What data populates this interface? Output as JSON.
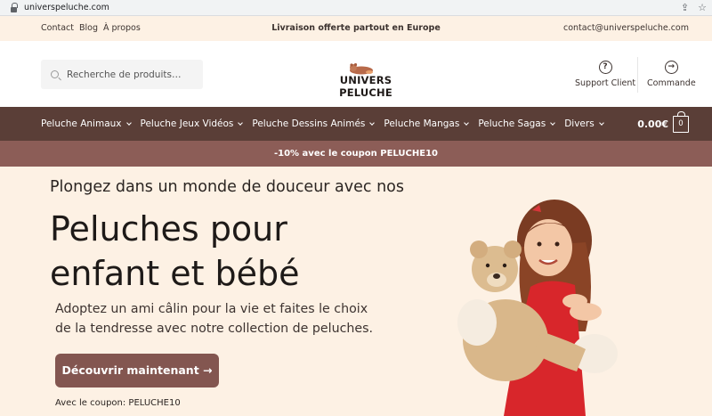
{
  "browser": {
    "url": "universpeluche.com"
  },
  "topbar": {
    "links": [
      "Contact",
      "Blog",
      "À propos"
    ],
    "announcement": "Livraison offerte partout en Europe",
    "email": "contact@universpeluche.com"
  },
  "header": {
    "search_placeholder": "Recherche de produits…",
    "logo_text": "UNIVERS PELUCHE",
    "support_label": "Support Client",
    "order_label": "Commande"
  },
  "nav": {
    "items": [
      "Peluche Animaux",
      "Peluche Jeux Vidéos",
      "Peluche Dessins Animés",
      "Peluche Mangas",
      "Peluche Sagas",
      "Divers"
    ],
    "cart_total": "0.00€",
    "cart_count": "0"
  },
  "coupon_bar": {
    "text": "-10% avec le coupon PELUCHE10"
  },
  "hero": {
    "subtitle": "Plongez dans un monde de douceur avec nos",
    "title": "Peluches pour enfant et bébé",
    "description": "Adoptez un ami câlin pour la vie et faites le choix de la tendresse avec notre collection de peluches.",
    "button_label": "Découvrir maintenant →",
    "coupon_note": "Avec le coupon: PELUCHE10"
  },
  "colors": {
    "nav_bg": "#5a3e37",
    "coupon_bg": "#8c5d57",
    "button_bg": "#835650",
    "hero_bg": "#fdf1e4"
  }
}
